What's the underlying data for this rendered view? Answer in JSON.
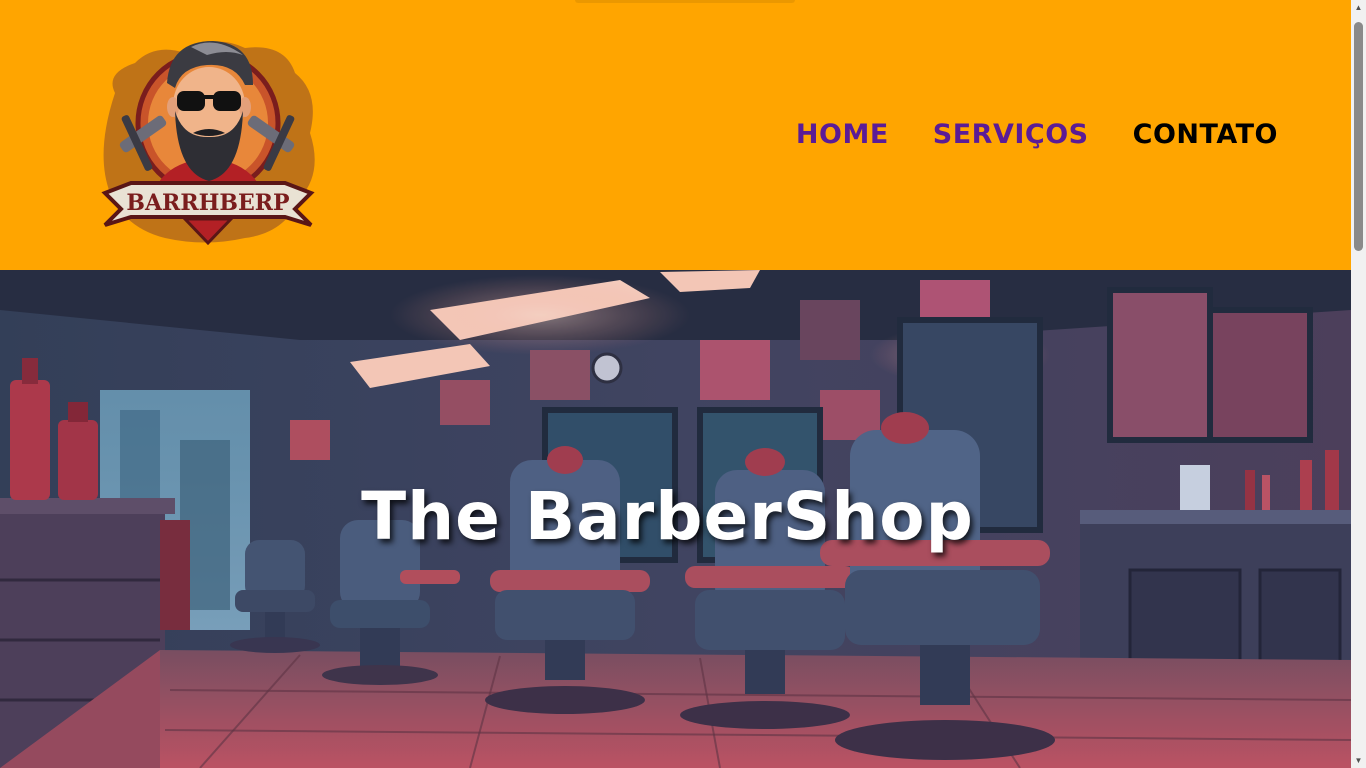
{
  "logo": {
    "text": "BARRHBERP"
  },
  "nav": {
    "items": [
      {
        "label": "HOME"
      },
      {
        "label": "SERVIÇOS"
      },
      {
        "label": "CONTATO"
      }
    ]
  },
  "hero": {
    "title": "The BarberShop"
  },
  "colors": {
    "header_bg": "#ffa500",
    "nav_link": "#5b1c96",
    "nav_link_active": "#000000",
    "hero_title": "#ffffff"
  }
}
